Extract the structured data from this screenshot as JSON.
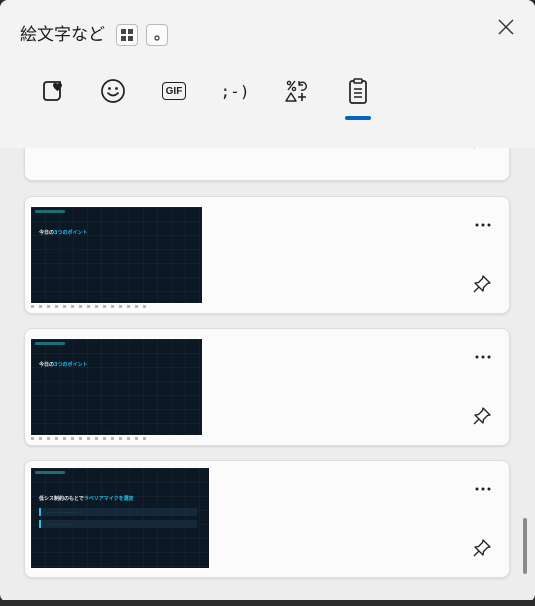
{
  "header": {
    "title": "絵文字など",
    "grid_button_icon": "grid-view-icon",
    "circle_button_icon": "small-circle-icon",
    "close_icon": "close-icon"
  },
  "tabs": [
    {
      "id": "favorites",
      "icon": "heart-sticker-icon"
    },
    {
      "id": "emoji",
      "icon": "smiley-icon"
    },
    {
      "id": "gif",
      "icon": "gif-icon",
      "label": "GIF"
    },
    {
      "id": "kaomoji",
      "icon": "kaomoji-icon",
      "label": ";-)"
    },
    {
      "id": "symbols",
      "icon": "symbols-icon"
    },
    {
      "id": "clipboard",
      "icon": "clipboard-icon",
      "selected": true
    }
  ],
  "colors": {
    "accent": "#0067c0",
    "slide_background": "#0c1824",
    "slide_highlight": "#25c3ea"
  },
  "clipboard_items": [
    {
      "kind": "partial",
      "actions": [
        "pin-icon"
      ]
    },
    {
      "kind": "image",
      "slide_title_prefix": "今日の",
      "slide_title_highlight": "3つのポイント",
      "actions": [
        "more-icon",
        "pin-icon"
      ]
    },
    {
      "kind": "image",
      "slide_title_prefix": "今日の",
      "slide_title_highlight": "3つのポイント",
      "actions": [
        "more-icon",
        "pin-icon"
      ]
    },
    {
      "kind": "image",
      "slide_title_prefix": "低シス制約のもとで",
      "slide_title_highlight": "ラベリアマイクを選定",
      "actions": [
        "more-icon",
        "pin-icon"
      ]
    }
  ]
}
